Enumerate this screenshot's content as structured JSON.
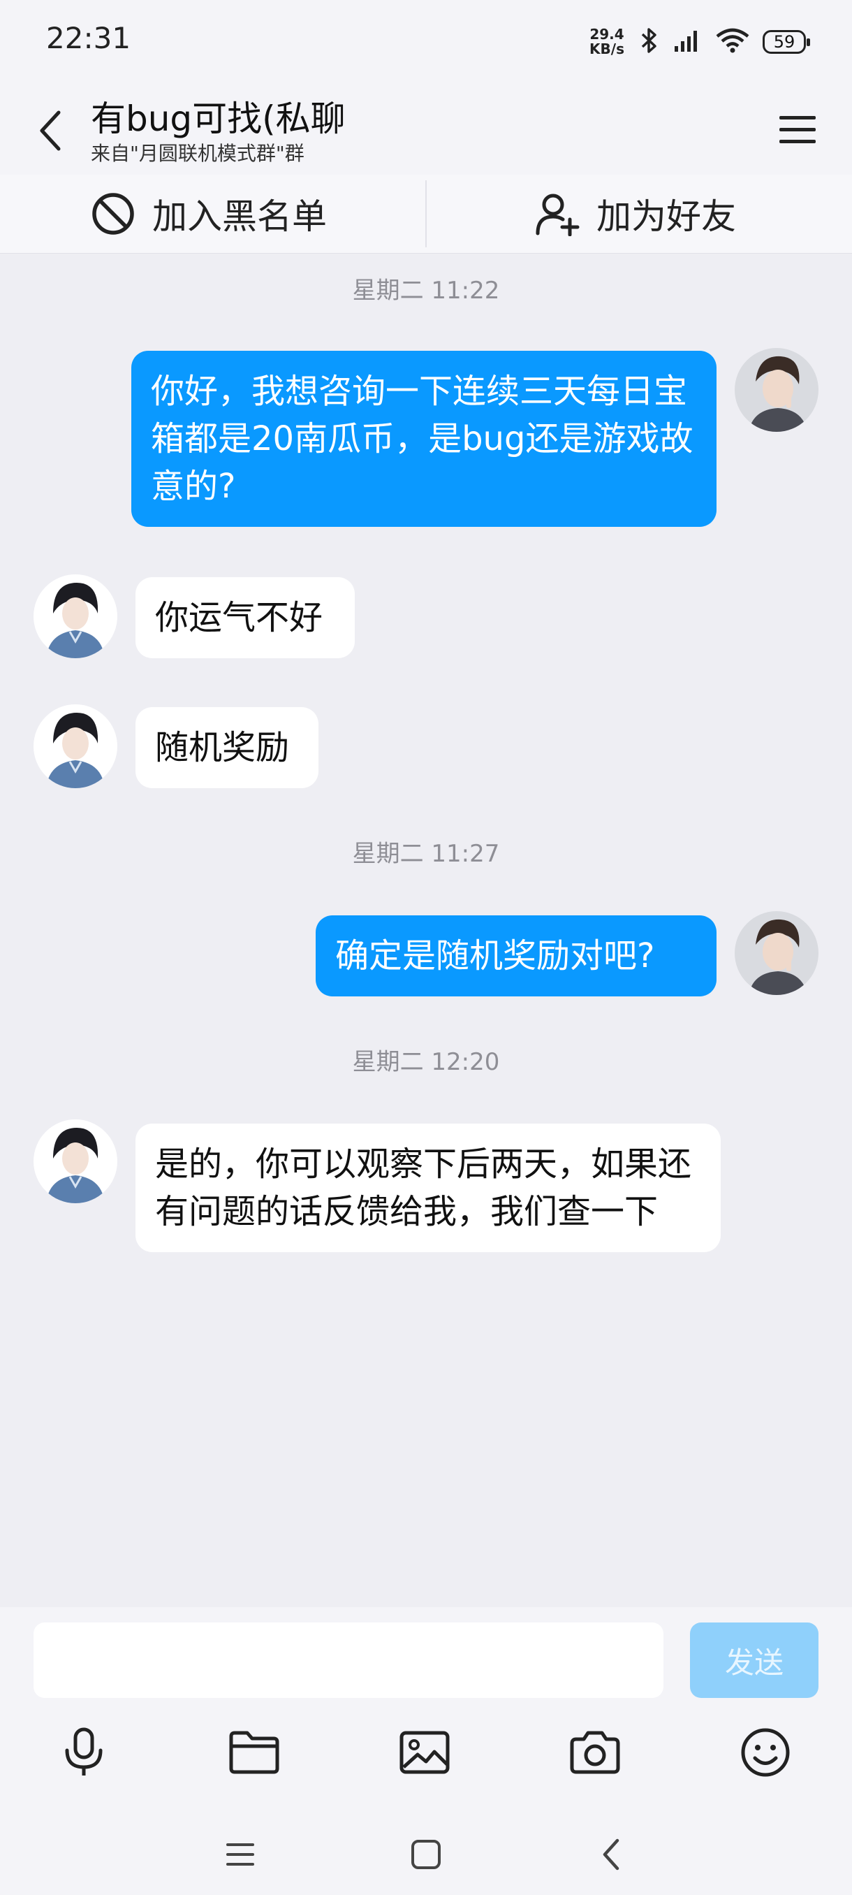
{
  "status": {
    "time": "22:31",
    "net_speed_value": "29.4",
    "net_speed_unit": "KB/s",
    "battery": "59"
  },
  "header": {
    "title": "有bug可找(私聊",
    "subtitle": "来自\"月圆联机模式群\"群"
  },
  "actions": {
    "block": "加入黑名单",
    "add_friend": "加为好友"
  },
  "messages": [
    {
      "type": "timestamp",
      "text": "星期二 11:22"
    },
    {
      "type": "mine",
      "text": "你好，我想咨询一下连续三天每日宝箱都是20南瓜币，是bug还是游戏故意的?"
    },
    {
      "type": "theirs",
      "text": "你运气不好"
    },
    {
      "type": "theirs",
      "text": "随机奖励"
    },
    {
      "type": "timestamp",
      "text": "星期二 11:27"
    },
    {
      "type": "mine",
      "text": "确定是随机奖励对吧?"
    },
    {
      "type": "timestamp",
      "text": "星期二 12:20"
    },
    {
      "type": "theirs",
      "text": "是的，你可以观察下后两天，如果还有问题的话反馈给我，我们查一下"
    }
  ],
  "composer": {
    "input_value": "",
    "send_label": "发送"
  },
  "icons": {
    "toolbar": [
      "microphone-icon",
      "folder-icon",
      "image-icon",
      "camera-icon",
      "emoji-icon"
    ],
    "nav": [
      "recents-icon",
      "home-icon",
      "back-icon"
    ]
  },
  "colors": {
    "my_bubble": "#0a99ff",
    "their_bubble": "#ffffff",
    "background": "#eeeef3",
    "send_button": "#8fd0fb"
  }
}
